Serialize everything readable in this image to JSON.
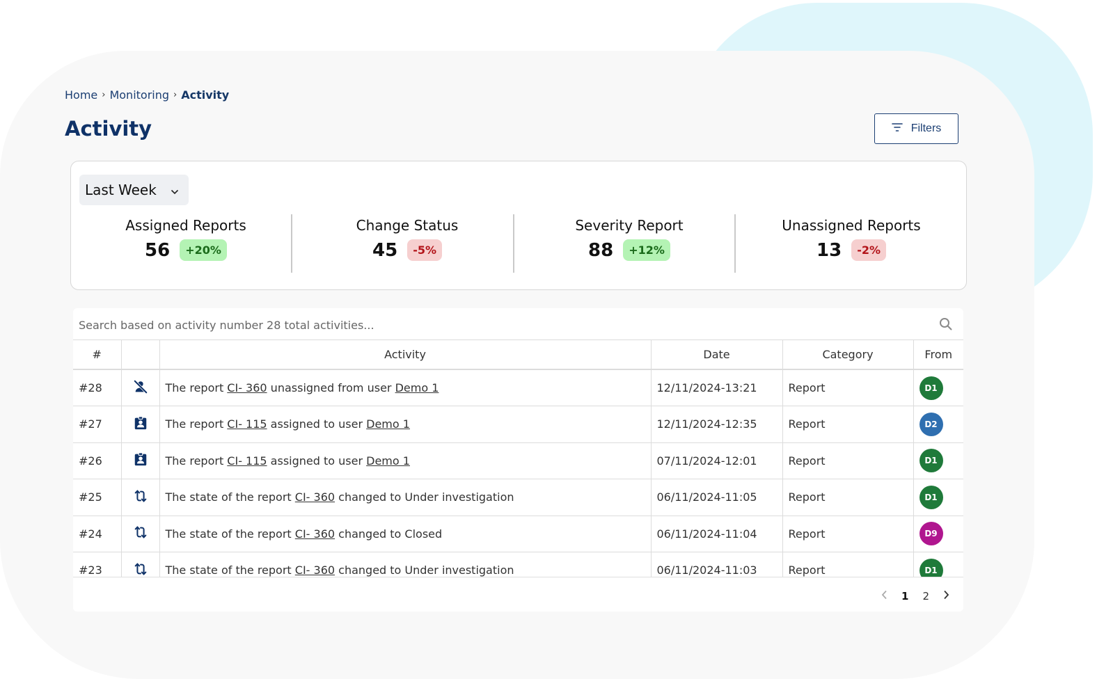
{
  "breadcrumb": {
    "home": "Home",
    "monitoring": "Monitoring",
    "current": "Activity",
    "separator": "›"
  },
  "page_title": "Activity",
  "filters_button": {
    "label": "Filters",
    "icon": "filter-lines-icon"
  },
  "period_select": {
    "value": "Last Week",
    "icon": "chevron-down-icon"
  },
  "stats": [
    {
      "label": "Assigned Reports",
      "value": "56",
      "change": "+20%",
      "trend": "up"
    },
    {
      "label": "Change Status",
      "value": "45",
      "change": "-5%",
      "trend": "down"
    },
    {
      "label": "Severity Report",
      "value": "88",
      "change": "+12%",
      "trend": "up"
    },
    {
      "label": "Unassigned Reports",
      "value": "13",
      "change": "-2%",
      "trend": "down"
    }
  ],
  "search": {
    "placeholder": "Search based on activity number 28 total activities...",
    "value": ""
  },
  "table": {
    "headers": {
      "num": "#",
      "icon": "",
      "activity": "Activity",
      "date": "Date",
      "category": "Category",
      "from": "From"
    },
    "rows": [
      {
        "num": "#28",
        "icon": "person-off-icon",
        "pre": "The report ",
        "report": "CI- 360",
        "mid": " unassigned from user ",
        "user": "Demo 1",
        "post": "",
        "date": "12/11/2024-13:21",
        "category": "Report",
        "from": "D1",
        "from_color": "#1f7a3a"
      },
      {
        "num": "#27",
        "icon": "assigned-badge-icon",
        "pre": "The report ",
        "report": "CI- 115",
        "mid": " assigned to user ",
        "user": "Demo 1",
        "post": "",
        "date": "12/11/2024-12:35",
        "category": "Report",
        "from": "D2",
        "from_color": "#2f6fb0"
      },
      {
        "num": "#26",
        "icon": "assigned-badge-icon",
        "pre": "The report ",
        "report": "CI- 115",
        "mid": " assigned to user ",
        "user": "Demo 1",
        "post": "",
        "date": "07/11/2024-12:01",
        "category": "Report",
        "from": "D1",
        "from_color": "#1f7a3a"
      },
      {
        "num": "#25",
        "icon": "status-change-icon",
        "pre": "The state of the report ",
        "report": "CI- 360",
        "mid": " changed to  Under investigation",
        "user": "",
        "post": "",
        "date": "06/11/2024-11:05",
        "category": "Report",
        "from": "D1",
        "from_color": "#1f7a3a"
      },
      {
        "num": "#24",
        "icon": "status-change-icon",
        "pre": "The state of the report ",
        "report": "CI- 360",
        "mid": " changed to  Closed",
        "user": "",
        "post": "",
        "date": "06/11/2024-11:04",
        "category": "Report",
        "from": "D9",
        "from_color": "#b0168f"
      },
      {
        "num": "#23",
        "icon": "status-change-icon",
        "pre": "The state of the report ",
        "report": "CI- 360",
        "mid": " changed to  Under investigation",
        "user": "",
        "post": "",
        "date": "06/11/2024-11:03",
        "category": "Report",
        "from": "D1",
        "from_color": "#1f7a3a"
      }
    ]
  },
  "pagination": {
    "pages": [
      "1",
      "2"
    ],
    "current": "1"
  },
  "colors": {
    "primary": "#0f3268",
    "up_bg": "#b4f3b4",
    "down_bg": "#f6cfcf"
  }
}
